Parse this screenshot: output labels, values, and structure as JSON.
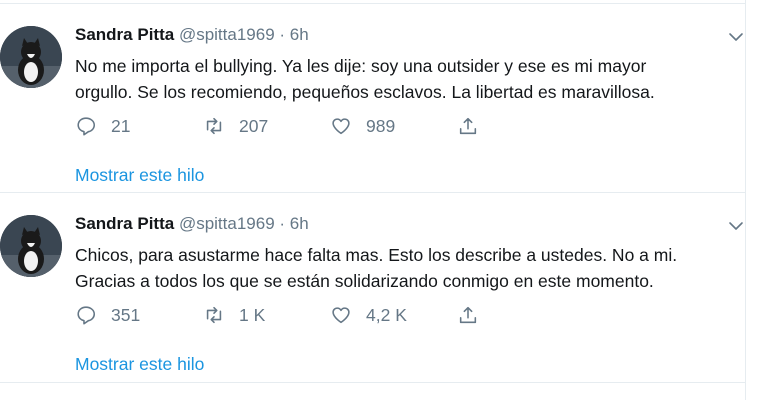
{
  "tweets": [
    {
      "name": "Sandra Pitta",
      "handle": "@spitta1969",
      "separator": "·",
      "time": "6h",
      "text_lines": [
        "No me importa el bullying. Ya les dije: soy una outsider y ese es mi mayor",
        "orgullo. Se los recomiendo, pequeños esclavos. La libertad es maravillosa."
      ],
      "replies": "21",
      "retweets": "207",
      "likes": "989",
      "show_thread": "Mostrar este hilo"
    },
    {
      "name": "Sandra Pitta",
      "handle": "@spitta1969",
      "separator": "·",
      "time": "6h",
      "text_lines": [
        "Chicos, para asustarme hace falta mas. Esto los describe a ustedes. No a mi.",
        "Gracias a todos los que se están solidarizando conmigo en este momento."
      ],
      "replies": "351",
      "retweets": "1 K",
      "likes": "4,2 K",
      "show_thread": "Mostrar este hilo"
    }
  ],
  "colors": {
    "link": "#1b95e0",
    "secondary": "#657786",
    "divider": "#e6ecf0"
  }
}
